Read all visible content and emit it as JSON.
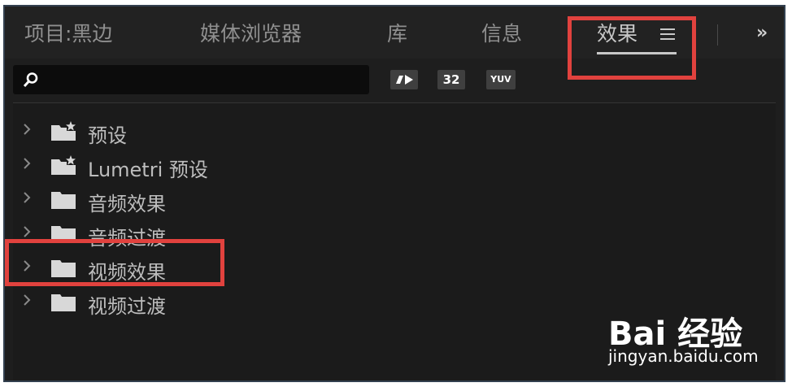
{
  "tabs": [
    {
      "label": "项目:黑边",
      "active": false
    },
    {
      "label": "媒体浏览器",
      "active": false
    },
    {
      "label": "库",
      "active": false
    },
    {
      "label": "信息",
      "active": false
    },
    {
      "label": "效果",
      "active": true
    }
  ],
  "tab_menu_icon": "hamburger-menu-icon",
  "overflow_label": "»",
  "search": {
    "placeholder": "",
    "value": "",
    "icon": "search-icon"
  },
  "filters": [
    {
      "label": "",
      "icon": "accelerated-effects-icon"
    },
    {
      "label": "32",
      "icon": "32-bit-color-icon"
    },
    {
      "label": "YUV",
      "icon": "yuv-effects-icon"
    }
  ],
  "effects_tree": [
    {
      "label": "预设",
      "icon": "preset-folder-icon",
      "expanded": false
    },
    {
      "label": "Lumetri 预设",
      "icon": "preset-folder-icon",
      "expanded": false
    },
    {
      "label": "音频效果",
      "icon": "folder-icon",
      "expanded": false
    },
    {
      "label": "音频过渡",
      "icon": "folder-icon",
      "expanded": false
    },
    {
      "label": "视频效果",
      "icon": "folder-icon",
      "expanded": false
    },
    {
      "label": "视频过渡",
      "icon": "folder-icon",
      "expanded": false
    }
  ],
  "watermark": {
    "logo": "Bai 经验",
    "url": "jingyan.baidu.com"
  },
  "colors": {
    "panel_bg": "#1e1e1e",
    "highlight": "#e1423e",
    "text": "#bdbdbd",
    "active_tab": "#c7c7c7"
  }
}
